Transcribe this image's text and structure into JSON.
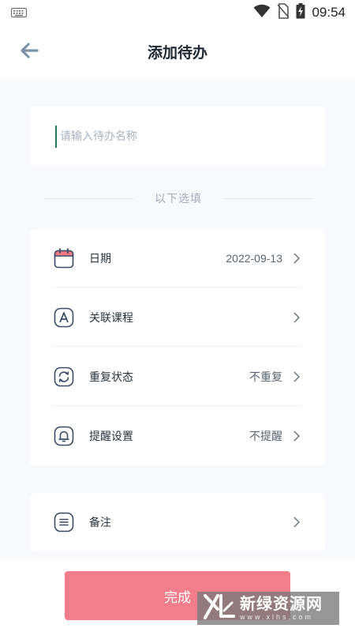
{
  "status_bar": {
    "time": "09:54",
    "icons": [
      "keyboard-icon",
      "wifi-icon",
      "no-sim-icon",
      "battery-charging-icon"
    ]
  },
  "header": {
    "title": "添加待办",
    "back_icon": "arrow-left-icon"
  },
  "name_field": {
    "placeholder": "请输入待办名称",
    "value": ""
  },
  "divider": {
    "text": "以下选填"
  },
  "options": [
    {
      "label": "日期",
      "value": "2022-09-13",
      "icon": "calendar-icon"
    },
    {
      "label": "关联课程",
      "value": "",
      "icon": "course-a-icon"
    },
    {
      "label": "重复状态",
      "value": "不重复",
      "icon": "repeat-icon"
    },
    {
      "label": "提醒设置",
      "value": "不提醒",
      "icon": "bell-icon"
    }
  ],
  "notes": {
    "label": "备注",
    "icon": "notes-icon"
  },
  "done_button": {
    "label": "完成"
  },
  "watermark": {
    "title": "新绿资源网",
    "subtitle": "www.xlhs.com"
  },
  "colors": {
    "accent_button": "#f17e8a",
    "back_arrow": "#7a94a8",
    "icon_stroke": "#3b4a66",
    "calendar_red": "#f07a7f",
    "background": "#f7f9fc"
  }
}
